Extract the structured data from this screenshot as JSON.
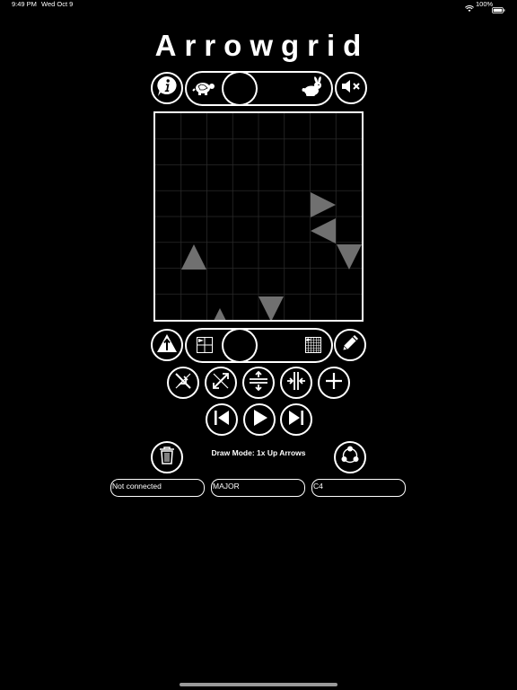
{
  "status_bar": {
    "time": "9:49 PM",
    "date": "Wed Oct 9",
    "battery": "100%",
    "icons": [
      "wifi-icon",
      "battery-icon"
    ]
  },
  "app": {
    "title": "Arrowgrid"
  },
  "top_controls": {
    "info_icon": "info-icon",
    "speed_slider": {
      "left_icon": "turtle-icon",
      "right_icon": "rabbit-icon"
    },
    "mute_icon": "speaker-mute-icon"
  },
  "grid": {
    "arrows": [
      {
        "dir": "right"
      },
      {
        "dir": "left"
      },
      {
        "dir": "down"
      },
      {
        "dir": "up"
      },
      {
        "dir": "down"
      },
      {
        "dir": "up"
      }
    ]
  },
  "grid_controls": {
    "arrow_mode_icon": "up-arrow-triangle-icon",
    "size_slider": {
      "left_icon": "small-grid-icon",
      "right_icon": "large-grid-icon"
    },
    "draw_icon": "pencil-icon"
  },
  "transform_row": [
    "shrink-diagonal-icon",
    "expand-diagonal-icon",
    "vertical-split-icon",
    "horizontal-split-icon",
    "plus-icon"
  ],
  "playback_row": [
    "skip-back-icon",
    "play-icon",
    "skip-forward-icon"
  ],
  "bottom": {
    "trash_icon": "trash-icon",
    "draw_mode": "Draw Mode: 1x Up Arrows",
    "share_icon": "share-icon"
  },
  "fields": {
    "midi_status": "Not connected",
    "scale": "MAJOR",
    "root_note": "C4"
  },
  "colors": {
    "background": "#000000",
    "foreground": "#ffffff",
    "arrow": "#707070"
  }
}
